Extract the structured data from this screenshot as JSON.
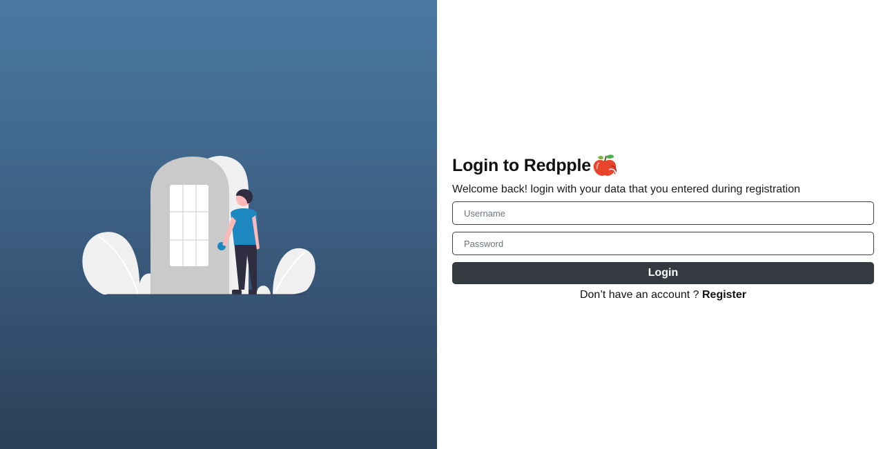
{
  "illustration": {
    "icon": "person-at-door-illustration",
    "colors": {
      "door": "#cacaca",
      "arch": "#f0f0f0",
      "window": "#ffffff",
      "shirt": "#1d87c0",
      "pants": "#2f2e41",
      "skin": "#ffb8b8",
      "hair": "#2f2e41",
      "leaf": "#f0f0f0",
      "doorknob": "#1d87c0"
    }
  },
  "login": {
    "title": "Login to Redpple",
    "logo_icon": "red-apple-logo-icon",
    "subtitle": "Welcome back! login with your data that you entered during registration",
    "username_placeholder": "Username",
    "password_placeholder": "Password",
    "login_button": "Login",
    "register_prompt": "Don’t have an account ? ",
    "register_link": "Register"
  },
  "colors": {
    "gradient_top": "#4a79a3",
    "gradient_bottom": "#2b3f56",
    "button": "#343a40",
    "apple": "#e8452c",
    "leaf": "#4caf50"
  }
}
